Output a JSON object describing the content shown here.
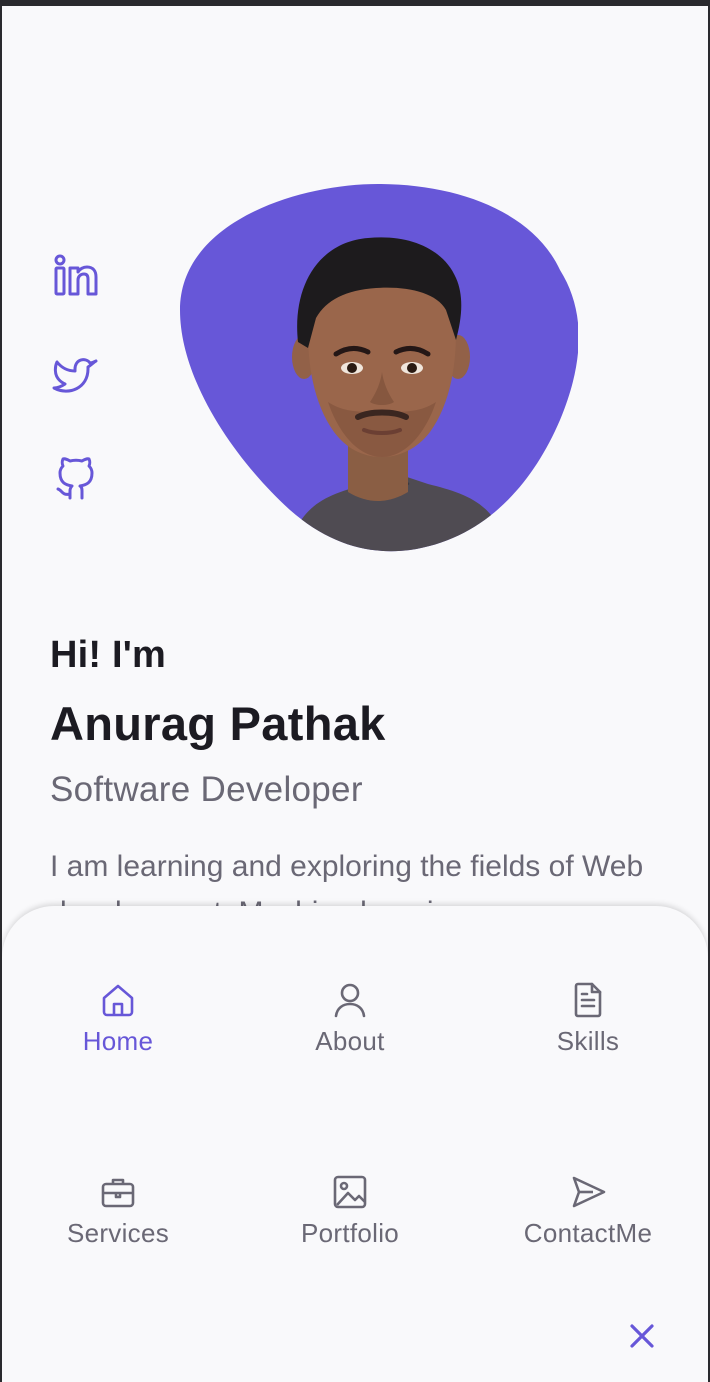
{
  "colors": {
    "accent": "#6757d8",
    "title": "#1c1b22",
    "text": "#6a6875",
    "background": "#f9f9fb"
  },
  "social": [
    {
      "icon": "linkedin-icon"
    },
    {
      "icon": "twitter-icon"
    },
    {
      "icon": "github-icon"
    }
  ],
  "hero": {
    "greeting": "Hi! I'm",
    "name": "Anurag Pathak",
    "role": "Software Developer",
    "description": "I am learning and exploring the fields of Web development, Machine learning"
  },
  "menu": {
    "items": [
      {
        "label": "Home",
        "icon": "home-icon",
        "active": true
      },
      {
        "label": "About",
        "icon": "user-icon",
        "active": false
      },
      {
        "label": "Skills",
        "icon": "file-icon",
        "active": false
      },
      {
        "label": "Services",
        "icon": "briefcase-icon",
        "active": false
      },
      {
        "label": "Portfolio",
        "icon": "image-icon",
        "active": false
      },
      {
        "label": "ContactMe",
        "icon": "send-icon",
        "active": false
      }
    ],
    "close_icon": "close-icon"
  }
}
